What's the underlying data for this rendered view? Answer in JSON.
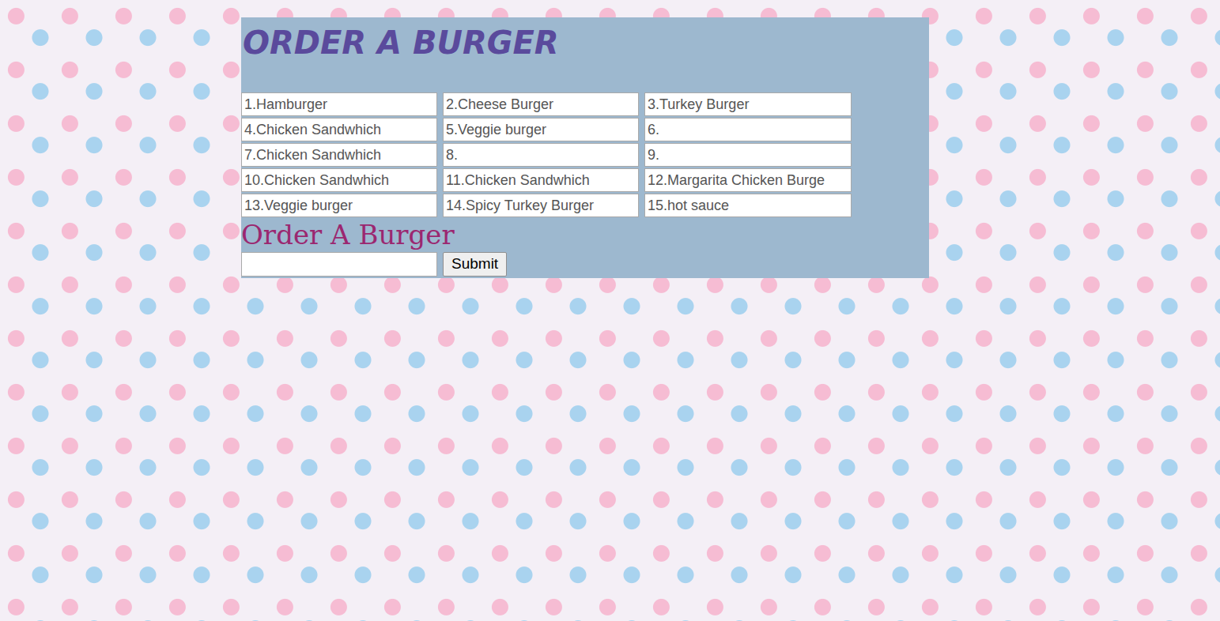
{
  "page": {
    "title": "ORDER A BURGER"
  },
  "menu": {
    "items": [
      "1.Hamburger",
      "2.Cheese Burger",
      "3.Turkey Burger",
      "4.Chicken Sandwhich",
      "5.Veggie burger",
      "6.",
      "7.Chicken Sandwhich",
      "8.",
      "9.",
      "10.Chicken Sandwhich",
      "11.Chicken Sandwhich",
      "12.Margarita Chicken Burge",
      "13.Veggie burger",
      "14.Spicy Turkey Burger",
      "15.hot sauce"
    ]
  },
  "order_form": {
    "heading": "Order A Burger",
    "input_value": "",
    "button": "Submit"
  }
}
